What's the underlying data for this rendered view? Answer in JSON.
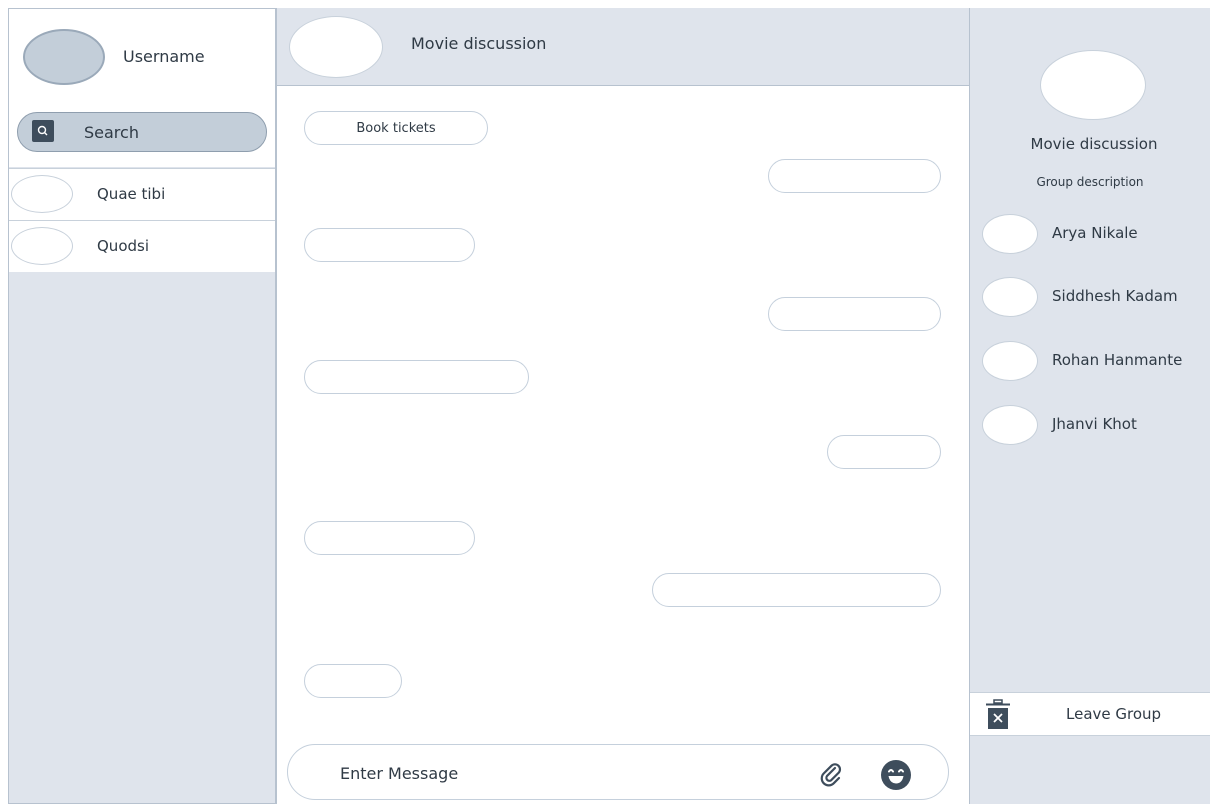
{
  "sidebar": {
    "username": "Username",
    "search_label": "Search",
    "contacts": [
      {
        "name": "Quae tibi"
      },
      {
        "name": "Quodsi"
      }
    ]
  },
  "chat": {
    "title": "Movie discussion",
    "messages": [
      {
        "side": "left",
        "text": "Book tickets"
      },
      {
        "side": "right",
        "text": ""
      },
      {
        "side": "left",
        "text": ""
      },
      {
        "side": "right",
        "text": ""
      },
      {
        "side": "left",
        "text": ""
      },
      {
        "side": "right",
        "text": ""
      },
      {
        "side": "left",
        "text": ""
      },
      {
        "side": "right",
        "text": ""
      },
      {
        "side": "left",
        "text": ""
      }
    ],
    "composer": {
      "placeholder": "Enter Message",
      "attach_icon": "paperclip-icon",
      "emoji_icon": "smiley-icon"
    }
  },
  "group": {
    "title": "Movie discussion",
    "description": "Group description",
    "members": [
      {
        "name": "Arya Nikale"
      },
      {
        "name": "Siddhesh Kadam"
      },
      {
        "name": "Rohan Hanmante"
      },
      {
        "name": "Jhanvi Khot"
      }
    ],
    "leave_label": "Leave Group",
    "leave_icon": "trash-icon"
  },
  "colors": {
    "panel": "#dfe4ec",
    "border": "#b7c2cf",
    "search_fill": "#c3ced9",
    "text": "#2f3a45"
  }
}
